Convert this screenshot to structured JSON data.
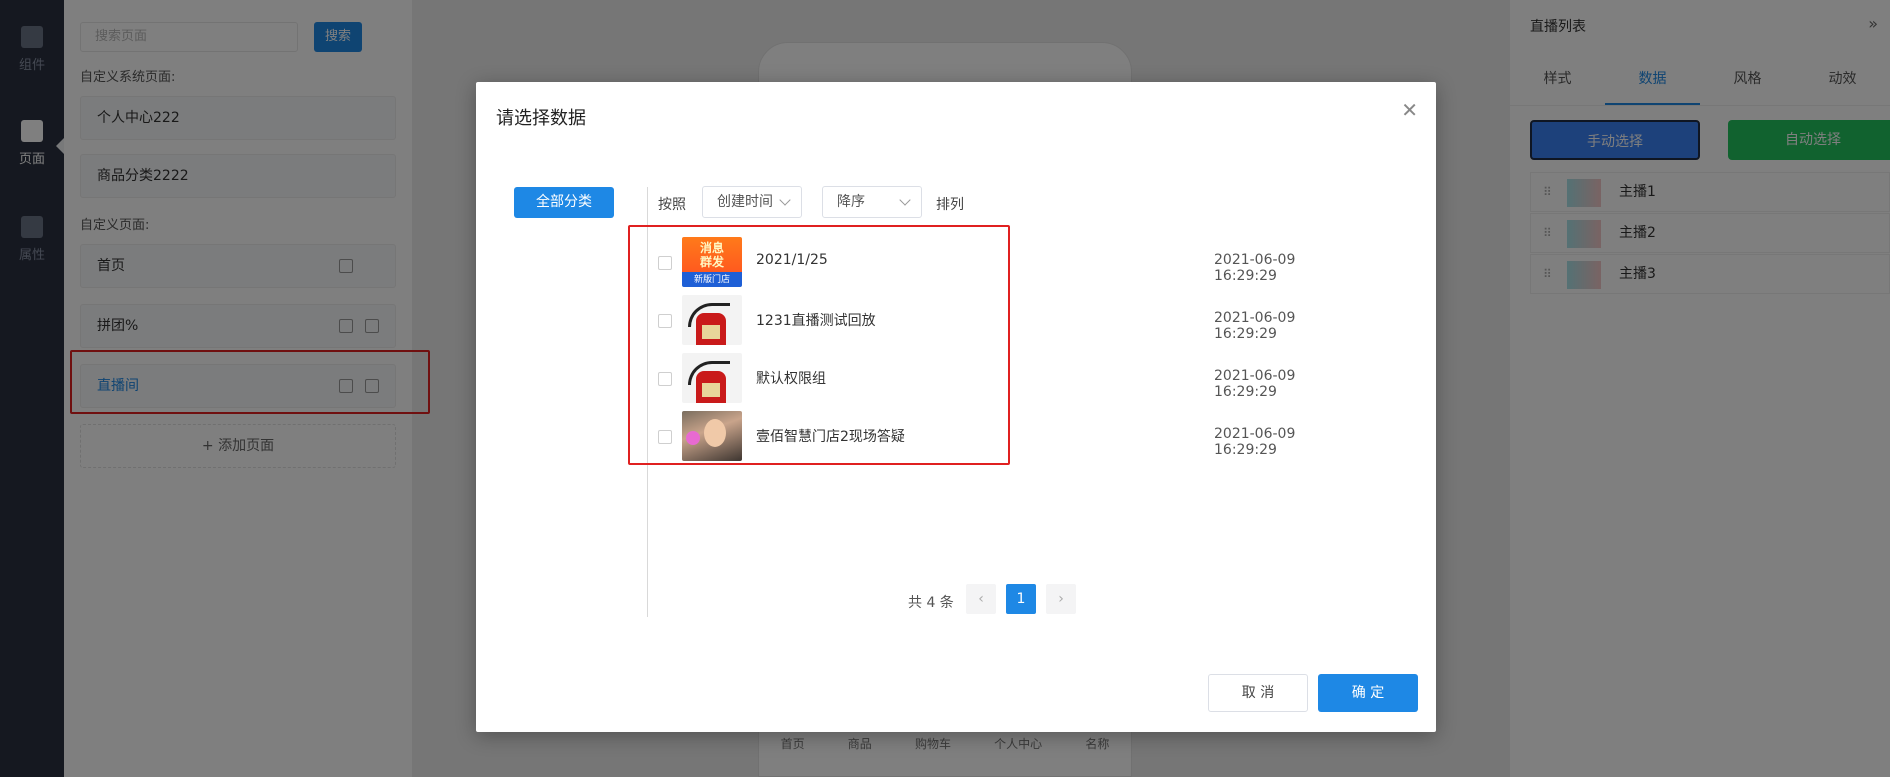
{
  "leftbar": {
    "items": [
      {
        "label": "组件",
        "icon": "component-icon"
      },
      {
        "label": "页面",
        "icon": "page-icon"
      },
      {
        "label": "属性",
        "icon": "property-icon"
      }
    ]
  },
  "pages_panel": {
    "search_placeholder": "搜索页面",
    "search_button": "搜索",
    "system_section": "自定义系统页面:",
    "system_pages": [
      "个人中心222",
      "商品分类2222"
    ],
    "custom_section": "自定义页面:",
    "custom_pages": [
      "首页",
      "拼团%",
      "直播间"
    ],
    "add_page": "添加页面"
  },
  "phone": {
    "nav": [
      "首页",
      "商品",
      "购物车",
      "个人中心",
      "名称"
    ]
  },
  "right_panel": {
    "title": "直播列表",
    "tabs": [
      "样式",
      "数据",
      "风格",
      "动效"
    ],
    "manual_button": "手动选择",
    "auto_button": "自动选择",
    "anchors": [
      "主播1",
      "主播2",
      "主播3"
    ]
  },
  "modal": {
    "title": "请选择数据",
    "category_button": "全部分类",
    "sort_by_label": "按照",
    "sort_field": "创建时间",
    "sort_order": "降序",
    "sort_suffix": "排列",
    "rows": [
      {
        "name": "2021/1/25",
        "time": "2021-06-09 16:29:29",
        "thumb_text_1": "消息",
        "thumb_text_2": "群发",
        "thumb_text_3": "新版门店"
      },
      {
        "name": "1231直播测试回放",
        "time": "2021-06-09 16:29:29"
      },
      {
        "name": "默认权限组",
        "time": "2021-06-09 16:29:29"
      },
      {
        "name": "壹佰智慧门店2现场答疑",
        "time": "2021-06-09 16:29:29"
      }
    ],
    "pager_total": "共 4 条",
    "current_page": "1",
    "cancel": "取 消",
    "confirm": "确 定"
  },
  "colors": {
    "primary": "#1e88e5",
    "highlight": "#e02020",
    "sidebar": "#2a3140"
  }
}
